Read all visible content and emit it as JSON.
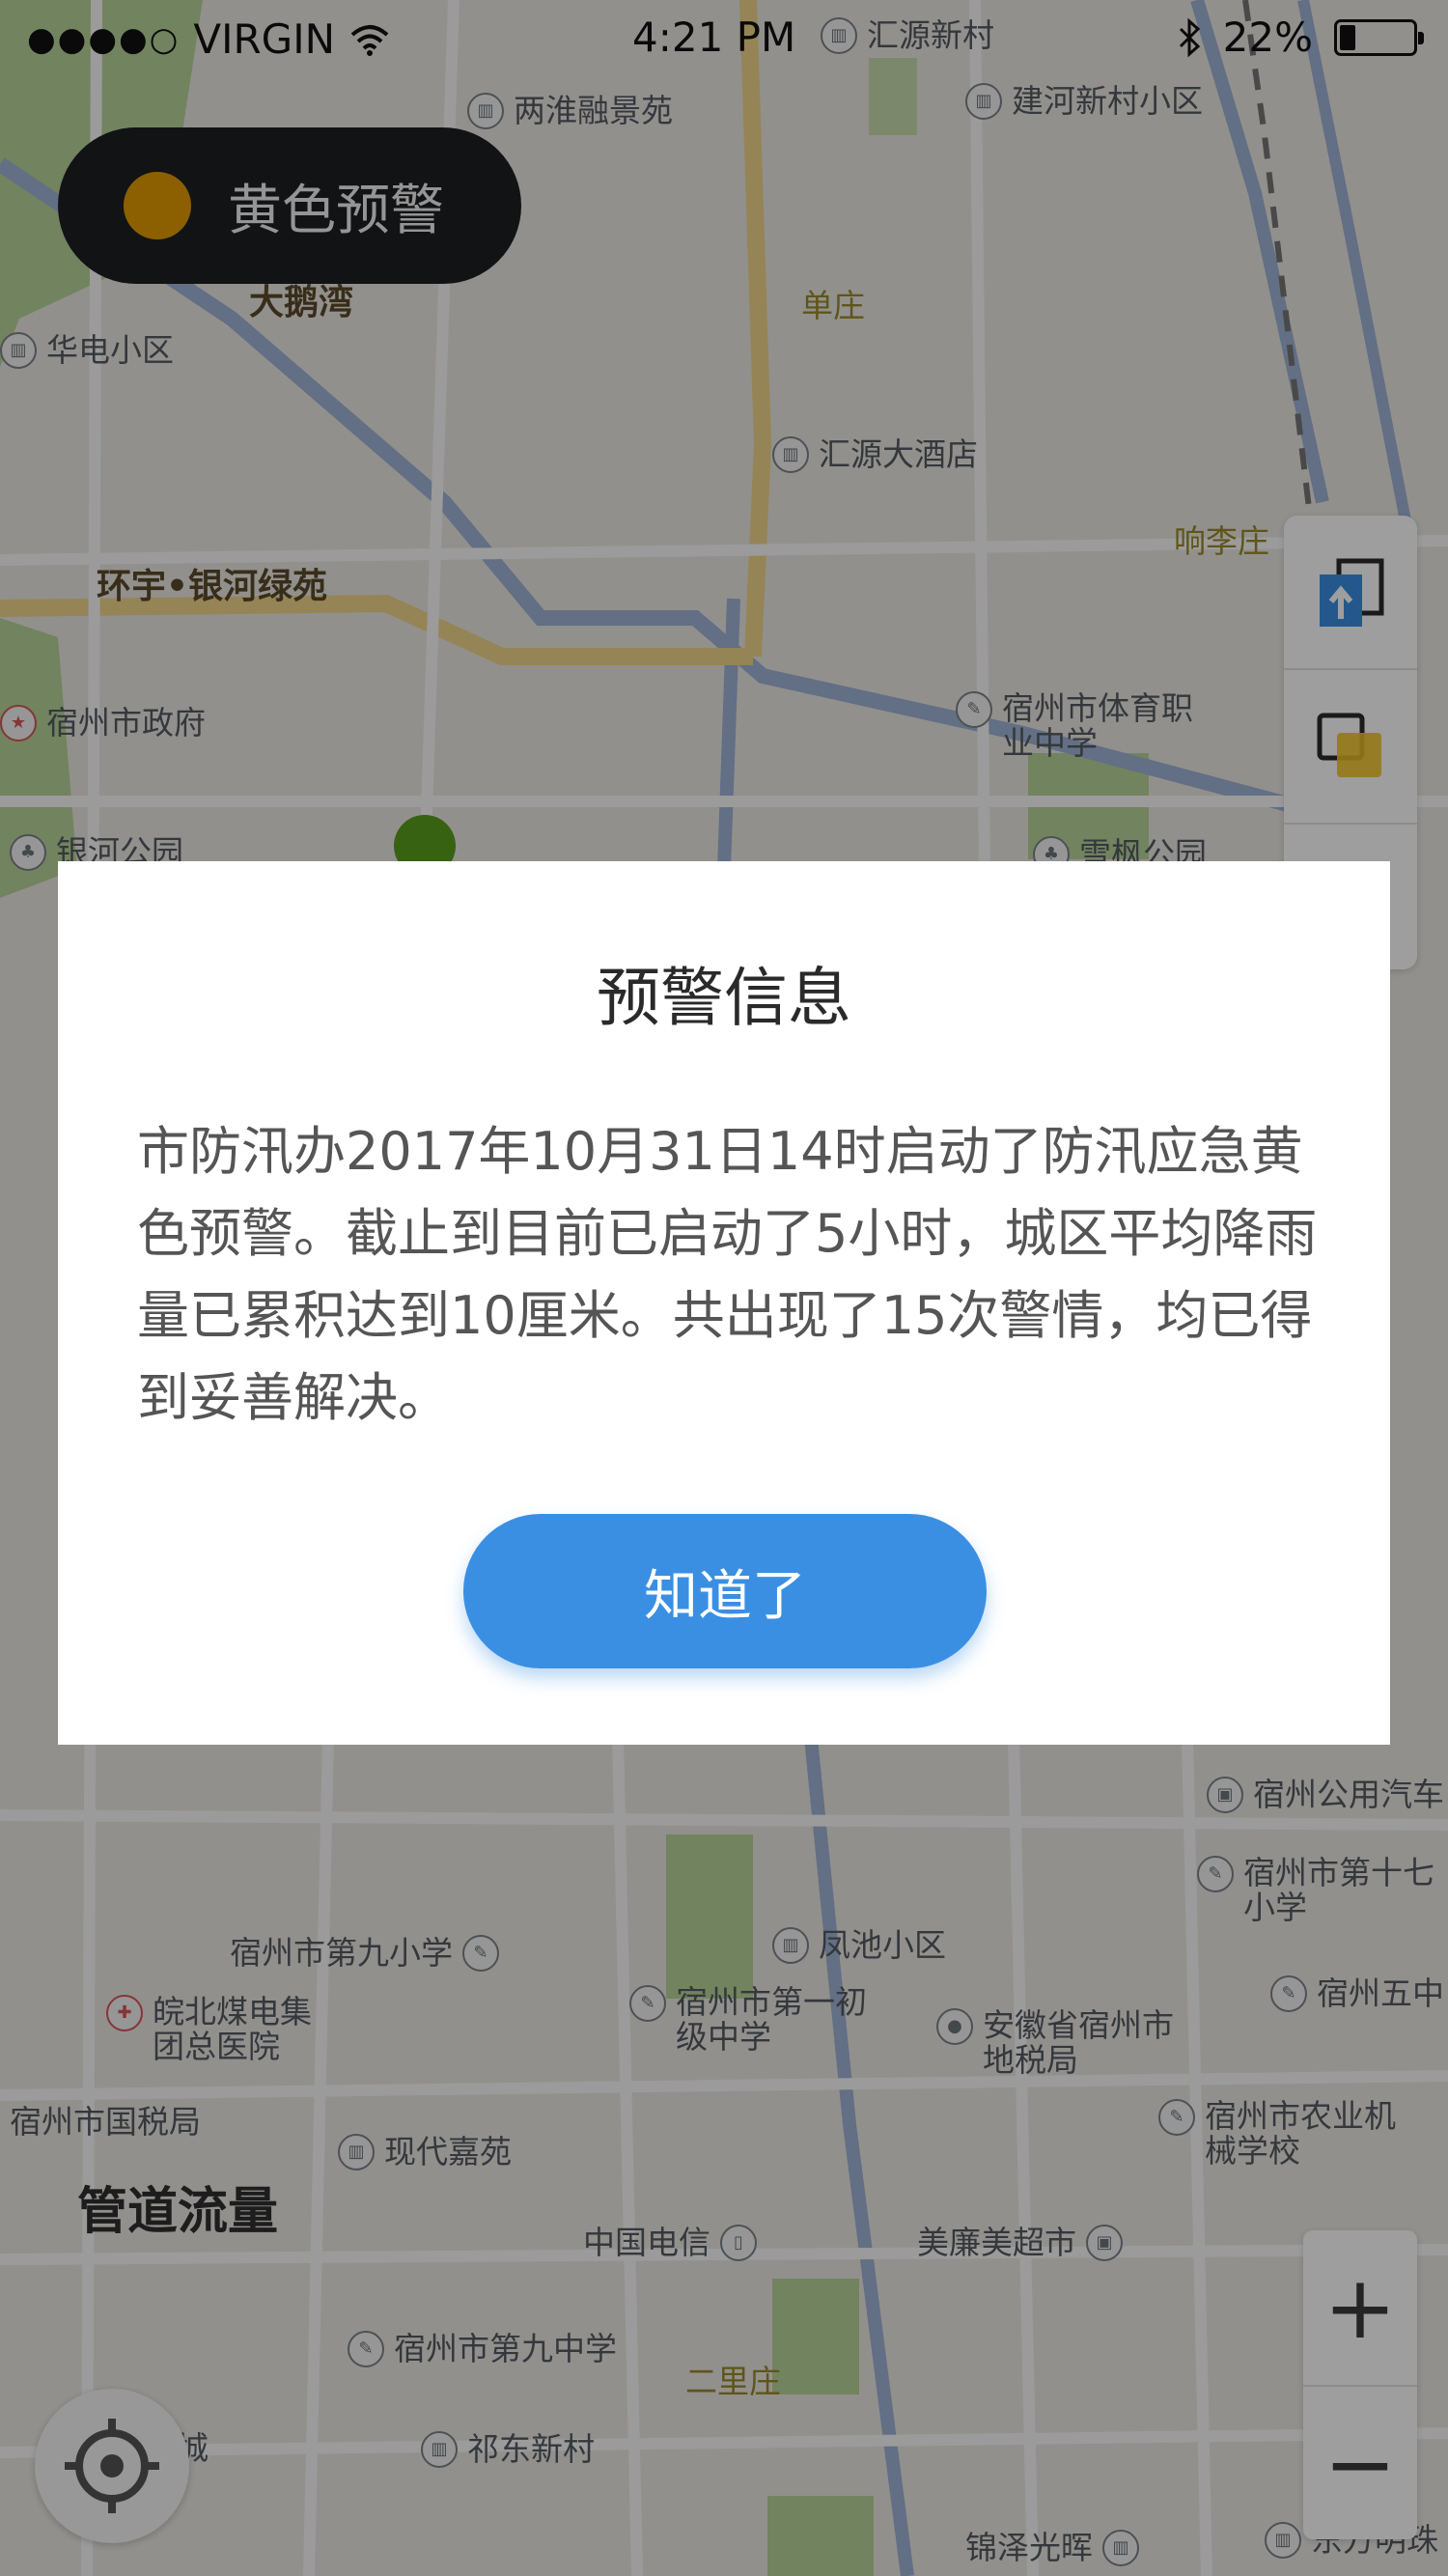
{
  "status_bar": {
    "signal": "●●●●○",
    "carrier": "VIRGIN",
    "time": "4:21 PM",
    "battery": "22%",
    "battery_level": 0.22
  },
  "warning_chip": {
    "label": "黄色预警",
    "dot_color": "#e39c00"
  },
  "map": {
    "pois": [
      "两淮融景苑",
      "建河新村小区",
      "汇源新村",
      "汇源大酒店",
      "华电小区",
      "宿州市政府",
      "银河公园",
      "宿州市体育职业中学",
      "雪枫公园",
      "宿州公用汽车",
      "宿州市第十七小学",
      "宿州五中",
      "凤池小区",
      "宿州市第九小学",
      "皖北煤电集团总医院",
      "宿州市第一初级中学",
      "安徽省宿州市地税局",
      "宿州市国税局",
      "现代嘉苑",
      "宿州市农业机械学校",
      "中国电信",
      "美廉美超市",
      "宿州市第九中学",
      "祁东新村",
      "锦泽光晖",
      "东方明珠",
      "纪城"
    ],
    "areas": [
      "单庄",
      "响李庄",
      "二里庄",
      "大鹅湾",
      "环宇•银河绿苑"
    ],
    "overlay_label": "管道流量"
  },
  "dialog": {
    "title": "预警信息",
    "body": "市防汛办2017年10月31日14时启动了防汛应急黄色预警。截止到目前已启动了5小时，城区平均降雨量已累积达到10厘米。共出现了15次警情，均已得到妥善解决。",
    "button": "知道了"
  },
  "controls": {
    "zoom_in": "+",
    "zoom_out": "−"
  },
  "colors": {
    "accent": "#3a8fe3",
    "warning": "#e39c00",
    "green_marker": "#5a9e1e"
  }
}
